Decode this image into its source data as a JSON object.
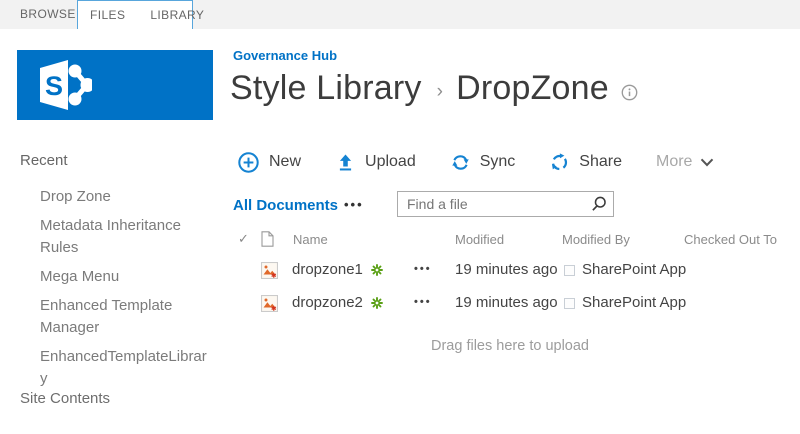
{
  "ribbon": {
    "tabs": [
      {
        "label": "BROWSE"
      },
      {
        "label": "FILES"
      },
      {
        "label": "LIBRARY"
      }
    ]
  },
  "logo": {
    "letter": "S"
  },
  "header": {
    "site_link": "Governance Hub",
    "title_primary": "Style Library",
    "title_separator": "›",
    "title_secondary": "DropZone"
  },
  "sidebar": {
    "recent_label": "Recent",
    "items": [
      {
        "label": "Drop Zone"
      },
      {
        "label": "Metadata Inheritance Rules"
      },
      {
        "label": "Mega Menu"
      },
      {
        "label": "Enhanced Template Manager"
      },
      {
        "label": "EnhancedTemplateLibrary"
      }
    ],
    "site_contents_label": "Site Contents"
  },
  "toolbar": {
    "buttons": [
      {
        "label": "New",
        "icon": "plus-circle-icon"
      },
      {
        "label": "Upload",
        "icon": "upload-icon"
      },
      {
        "label": "Sync",
        "icon": "sync-icon"
      },
      {
        "label": "Share",
        "icon": "share-icon"
      }
    ],
    "more_label": "More"
  },
  "view_bar": {
    "current_view": "All Documents",
    "menu_glyph": "•••",
    "search_placeholder": "Find a file"
  },
  "table": {
    "select_all_glyph": "✓",
    "columns": [
      "Name",
      "Modified",
      "Modified By",
      "Checked Out To"
    ],
    "row_menu_glyph": "•••",
    "rows": [
      {
        "name": "dropzone1",
        "is_new": true,
        "modified": "19 minutes ago",
        "modified_by": "SharePoint App",
        "checked_out_to": ""
      },
      {
        "name": "dropzone2",
        "is_new": true,
        "modified": "19 minutes ago",
        "modified_by": "SharePoint App",
        "checked_out_to": ""
      }
    ]
  },
  "dropzone_hint": "Drag files here to upload",
  "colors": {
    "brand_blue": "#0072c6",
    "toolbar_icon_blue": "#1583d2",
    "new_badge_green": "#5aa016",
    "topbar_bg": "#f2f2f2",
    "contextual_tab_border": "#58a6dc",
    "text_dark": "#444444",
    "text_gray": "#8b8b8b"
  }
}
